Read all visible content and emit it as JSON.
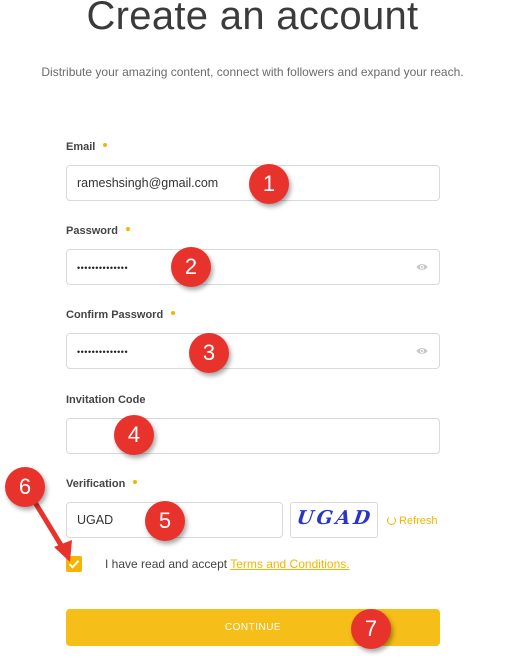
{
  "header": {
    "title": "Create an account",
    "subtitle": "Distribute your amazing content, connect with followers and expand your reach."
  },
  "form": {
    "email": {
      "label": "Email",
      "value": "rameshsingh@gmail.com"
    },
    "password": {
      "label": "Password",
      "value_masked": "••••••••••••••"
    },
    "confirm_password": {
      "label": "Confirm Password",
      "value_masked": "••••••••••••••"
    },
    "invitation_code": {
      "label": "Invitation Code",
      "value": ""
    },
    "verification": {
      "label": "Verification",
      "value": "UGAD",
      "captcha_text": "UGAD",
      "refresh_label": "Refresh"
    },
    "terms": {
      "text": "I have read and accept ",
      "link": "Terms and Conditions.",
      "checked": true
    },
    "continue_label": "CONTINUE"
  },
  "annotations": [
    "1",
    "2",
    "3",
    "4",
    "5",
    "6",
    "7"
  ],
  "colors": {
    "accent": "#f4b400",
    "button": "#f5be18",
    "annotation": "#e8322c",
    "captcha": "#2b34c9"
  }
}
